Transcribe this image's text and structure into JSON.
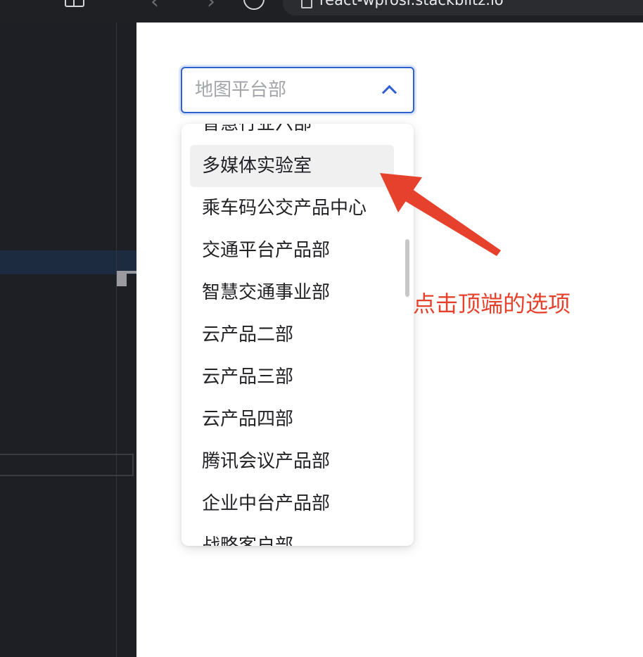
{
  "browser": {
    "url": "react-wprosi.stackblitz.io",
    "icons": [
      "tabs-icon",
      "sidebar-icon",
      "back-icon",
      "forward-icon",
      "reload-icon",
      "lock-icon"
    ]
  },
  "select": {
    "value": "地图平台部",
    "border_color": "#2f5fd3"
  },
  "dropdown": {
    "options": [
      "智慧行业六部",
      "多媒体实验室",
      "乘车码公交产品中心",
      "交通平台产品部",
      "智慧交通事业部",
      "云产品二部",
      "云产品三部",
      "云产品四部",
      "腾讯会议产品部",
      "企业中台产品部",
      "战略客户部"
    ],
    "hovered_option": "多媒体实验室"
  },
  "annotation": {
    "text": "点击顶端的选项",
    "color": "#e6412c"
  }
}
